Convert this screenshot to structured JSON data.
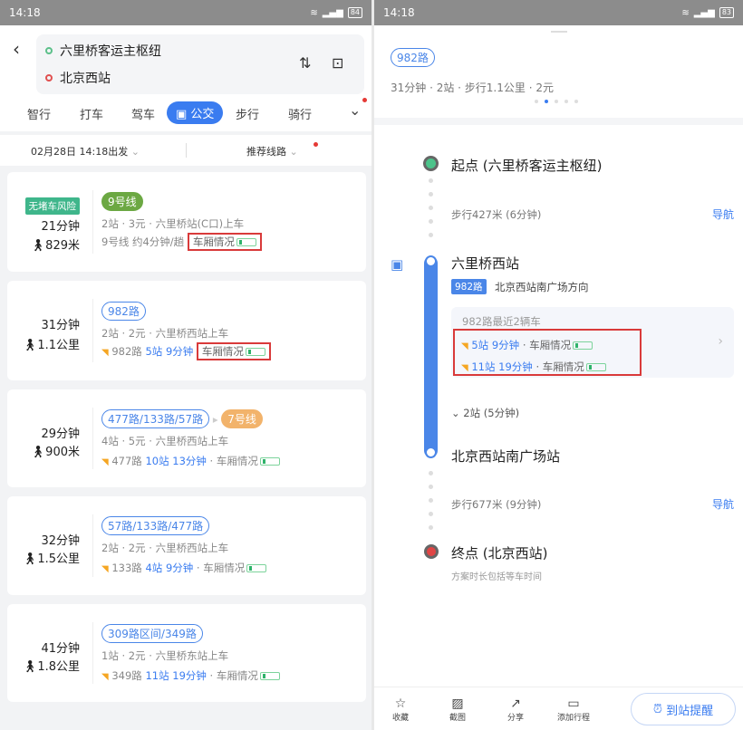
{
  "status": {
    "left_time": "14:18",
    "left_battery": "84",
    "right_time": "14:18",
    "right_battery": "83"
  },
  "search": {
    "origin": "六里桥客运主枢纽",
    "destination": "北京西站"
  },
  "modes": [
    "智行",
    "打车",
    "驾车",
    "公交",
    "步行",
    "骑行"
  ],
  "filter": {
    "depart": "02月28日 14:18出发",
    "sort": "推荐线路"
  },
  "routes": [
    {
      "badge": "无堵车风险",
      "time": "21分钟",
      "walk": "829米",
      "lines": [
        "9号线"
      ],
      "info": "2站 · 3元 · 六里桥站(C口)上车",
      "freq": "9号线 约4分钟/趟",
      "crowd": "车厢情况"
    },
    {
      "time": "31分钟",
      "walk": "1.1公里",
      "lines": [
        "982路"
      ],
      "info": "2站 · 2元 · 六里桥西站上车",
      "route": "982路",
      "eta": "5站 9分钟",
      "crowd": "车厢情况"
    },
    {
      "time": "29分钟",
      "walk": "900米",
      "lines": [
        "477路/133路/57路",
        "7号线"
      ],
      "info": "4站 · 5元 · 六里桥西站上车",
      "route": "477路",
      "eta": "10站 13分钟",
      "crowd": "· 车厢情况"
    },
    {
      "time": "32分钟",
      "walk": "1.5公里",
      "lines": [
        "57路/133路/477路"
      ],
      "info": "2站 · 2元 · 六里桥西站上车",
      "route": "133路",
      "eta": "4站 9分钟",
      "crowd": "· 车厢情况"
    },
    {
      "time": "41分钟",
      "walk": "1.8公里",
      "lines": [
        "309路区间/349路"
      ],
      "info": "1站 · 2元 · 六里桥东站上车",
      "route": "349路",
      "eta": "11站 19分钟",
      "crowd": "· 车厢情况"
    }
  ],
  "detail": {
    "line": "982路",
    "summary": "31分钟 · 2站 · 步行1.1公里 · 2元",
    "start": "起点 (六里桥客运主枢纽)",
    "walk1": "步行427米 (6分钟)",
    "nav": "导航",
    "board": "六里桥西站",
    "board_line": "982路",
    "direction": "北京西站南广场方向",
    "recent": "982路最近2辆车",
    "buses": [
      {
        "eta": "5站 9分钟",
        "crowd": "· 车厢情况"
      },
      {
        "eta": "11站 19分钟",
        "crowd": "· 车厢情况"
      }
    ],
    "stops": "2站 (5分钟)",
    "alight": "北京西站南广场站",
    "walk2": "步行677米 (9分钟)",
    "end": "终点 (北京西站)",
    "note": "方案时长包括等车时间"
  },
  "footer": {
    "fav": "收藏",
    "shot": "截图",
    "share": "分享",
    "add": "添加行程",
    "remind": "到站提醒"
  }
}
